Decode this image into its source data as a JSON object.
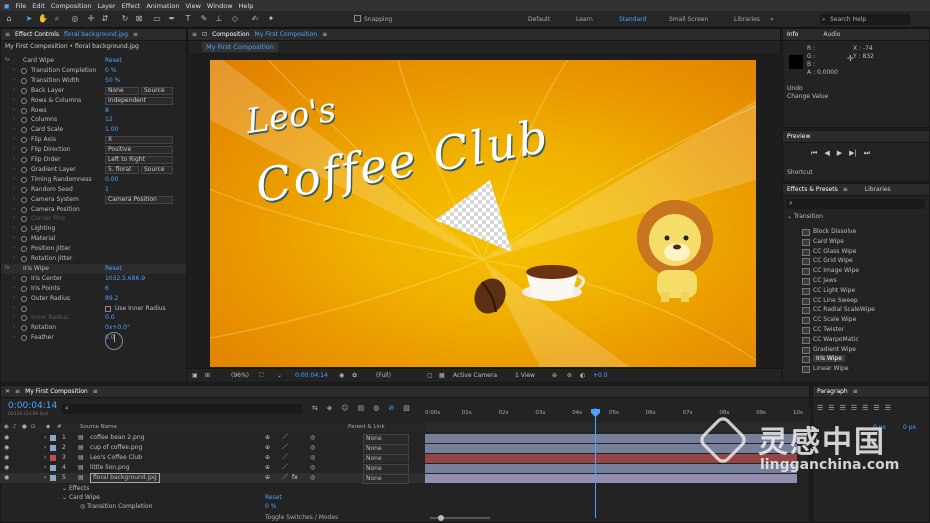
{
  "menu": [
    "File",
    "Edit",
    "Composition",
    "Layer",
    "Effect",
    "Animation",
    "View",
    "Window",
    "Help"
  ],
  "toolbar": {
    "snapping": "Snapping",
    "workspaces": [
      "Default",
      "Learn",
      "Standard",
      "Small Screen",
      "Libraries"
    ],
    "active_workspace": "Standard",
    "search": "Search Help"
  },
  "effect_controls": {
    "tab": "Effect Controls",
    "tab_file": "floral background.jpg",
    "subtitle": "My First Composition • floral background.jpg",
    "rows": [
      {
        "name": "Card Wipe",
        "value": "Reset",
        "level": 0
      },
      {
        "name": "Transition Completion",
        "value": "0 %",
        "level": 1
      },
      {
        "name": "Transition Width",
        "value": "50 %",
        "level": 1
      },
      {
        "name": "Back Layer",
        "dropdown": "None",
        "dropdown2": "Source",
        "level": 1
      },
      {
        "name": "Rows & Columns",
        "dropdown": "Independent",
        "level": 1
      },
      {
        "name": "Rows",
        "value": "8",
        "level": 1
      },
      {
        "name": "Columns",
        "value": "12",
        "level": 1
      },
      {
        "name": "Card Scale",
        "value": "1.00",
        "level": 1
      },
      {
        "name": "Flip Axis",
        "dropdown": "X",
        "level": 1
      },
      {
        "name": "Flip Direction",
        "dropdown": "Positive",
        "level": 1
      },
      {
        "name": "Flip Order",
        "dropdown": "Left to Right",
        "level": 1
      },
      {
        "name": "Gradient Layer",
        "dropdown": "5. floral",
        "dropdown2": "Source",
        "level": 1
      },
      {
        "name": "Timing Randomness",
        "value": "0.00",
        "level": 1
      },
      {
        "name": "Random Seed",
        "value": "1",
        "level": 1
      },
      {
        "name": "Camera System",
        "dropdown": "Camera Position",
        "level": 1
      },
      {
        "name": "Camera Position",
        "level": 1
      },
      {
        "name": "Corner Pins",
        "level": 1,
        "dim": true
      },
      {
        "name": "Lighting",
        "level": 1
      },
      {
        "name": "Material",
        "level": 1
      },
      {
        "name": "Position Jitter",
        "level": 1
      },
      {
        "name": "Rotation Jitter",
        "level": 1
      },
      {
        "name": "Iris Wipe",
        "value": "Reset",
        "level": 0,
        "highlight": true
      },
      {
        "name": "Iris Center",
        "value": "1032.5,686.9",
        "level": 1
      },
      {
        "name": "Iris Points",
        "value": "6",
        "level": 1
      },
      {
        "name": "Outer Radius",
        "value": "89.2",
        "level": 1
      },
      {
        "name": "",
        "checkbox": "Use Inner Radius",
        "level": 1
      },
      {
        "name": "Inner Radius",
        "value": "0.0",
        "level": 1,
        "dim": true
      },
      {
        "name": "Rotation",
        "value": "0x+0.0°",
        "level": 1
      },
      {
        "name": "Feather",
        "value": "0.0",
        "level": 1
      }
    ]
  },
  "composition": {
    "tab": "Composition",
    "tab_name": "My First Composition",
    "sub_tab": "My First Composition",
    "art": {
      "line1": "Leo's",
      "line2": "Coffee Club"
    },
    "footer": {
      "zoom": "(96%)",
      "timecode": "0:00:04:14",
      "resolution": "(Full)",
      "camera": "Active Camera",
      "views": "1 View",
      "offset": "+0.0"
    }
  },
  "info": {
    "tabs": [
      "Info",
      "Audio"
    ],
    "r": "R :",
    "g": "G :",
    "b": "B :",
    "a": "A : 0.0000",
    "x": "X : -74",
    "y": "Y : 832",
    "undo": "Undo",
    "change_value": "Change Value"
  },
  "preview": {
    "title": "Preview",
    "shortcut": "Shortcut"
  },
  "effects_presets": {
    "tabs": [
      "Effects & Presets",
      "Libraries"
    ],
    "category": "Transition",
    "items": [
      "Block Dissolve",
      "Card Wipe",
      "CC Glass Wipe",
      "CC Grid Wipe",
      "CC Image Wipe",
      "CC Jaws",
      "CC Light Wipe",
      "CC Line Sweep",
      "CC Radial ScaleWipe",
      "CC Scale Wipe",
      "CC Twister",
      "CC WarpoMatic",
      "Gradient Wipe",
      "Iris Wipe",
      "Linear Wipe"
    ],
    "selected": "Iris Wipe"
  },
  "timeline": {
    "tab": "My First Composition",
    "timecode": "0:00:04:14",
    "fps": "00110 (24.00 fps)",
    "col_source": "Source Name",
    "col_parent": "Parent & Link",
    "ticks": [
      "0:00s",
      "01s",
      "02s",
      "03s",
      "04s",
      "05s",
      "06s",
      "07s",
      "08s",
      "09s",
      "10s"
    ],
    "layers": [
      {
        "num": "1",
        "name": "coffee bean 2.png",
        "parent": "None",
        "color": "#8fa7c7"
      },
      {
        "num": "2",
        "name": "cup of coffee.png",
        "parent": "None",
        "color": "#8fa7c7"
      },
      {
        "num": "3",
        "name": "Leo's Coffee Club",
        "parent": "None",
        "color": "#c24b4b"
      },
      {
        "num": "4",
        "name": "little lion.png",
        "parent": "None",
        "color": "#8fa7c7"
      },
      {
        "num": "5",
        "name": "floral background.jpg",
        "parent": "None",
        "color": "#8fa7c7"
      }
    ],
    "effects_label": "Effects",
    "card_wipe": "Card Wipe",
    "card_wipe_reset": "Reset",
    "transition_completion": "Transition Completion",
    "transition_value": "0 %",
    "toggle": "Toggle Switches / Modes"
  },
  "paragraph": {
    "title": "Paragraph",
    "px1": "0 px",
    "px2": "0 px"
  },
  "watermark": {
    "cn": "灵感中国",
    "url": "lingganchina.com"
  }
}
